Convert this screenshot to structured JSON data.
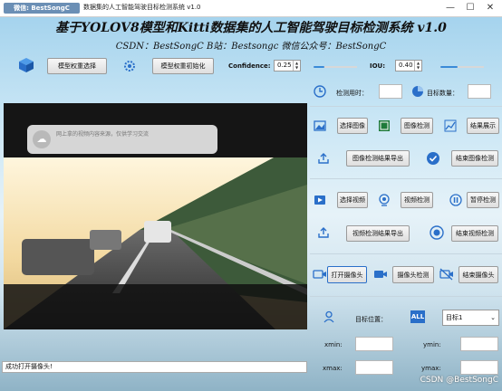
{
  "window": {
    "badge": "微信: BestSongC",
    "title": "数据集的人工智能驾驶目标检测系统 v1.0",
    "minimize": "—",
    "maximize": "☐",
    "close": "✕"
  },
  "header": {
    "title": "基于YOLOV8模型和Kitti数据集的人工智能驾驶目标检测系统 v1.0",
    "subtitle": "CSDN：BestSongC   B站：Bestsongc   微信公众号：BestSongC"
  },
  "toolbar": {
    "model_select_label": "模型权重选择",
    "model_init_label": "模型权重初始化",
    "confidence_label": "Confidence:",
    "confidence_value": "0.25",
    "confidence_level": 0.25,
    "iou_label": "IOU:",
    "iou_value": "0.40",
    "iou_level": 0.4
  },
  "stats": {
    "time_label": "检测用时：",
    "time_value": "",
    "count_label": "目标数量：",
    "count_value": ""
  },
  "image_section": {
    "select_label": "选择图像",
    "detect_label": "图像检测",
    "show_label": "结果展示",
    "export_label": "图像检测结果导出",
    "end_label": "结束图像检测"
  },
  "video_section": {
    "select_label": "选择视频",
    "detect_label": "视频检测",
    "pause_label": "暂停检测",
    "export_label": "视频检测结果导出",
    "end_label": "结束视频检测"
  },
  "camera_section": {
    "open_label": "打开摄像头",
    "detect_label": "摄像头检测",
    "end_label": "结束摄像头"
  },
  "target": {
    "position_label": "目标位置：",
    "all_badge": "ALL",
    "selected_target": "目标1",
    "xmin_label": "xmin:",
    "ymin_label": "ymin:",
    "xmax_label": "xmax:",
    "ymax_label": "ymax:"
  },
  "video": {
    "notification_text_line1": "网上拿的视频内容来源，仅供学习交流",
    "notification_text_line2": ""
  },
  "status": {
    "message": "成功打开摄像头!"
  },
  "watermark": "CSDN @BestSongC",
  "colors": {
    "accent": "#3a8ad8",
    "icon_blue": "#2a6fc9"
  }
}
